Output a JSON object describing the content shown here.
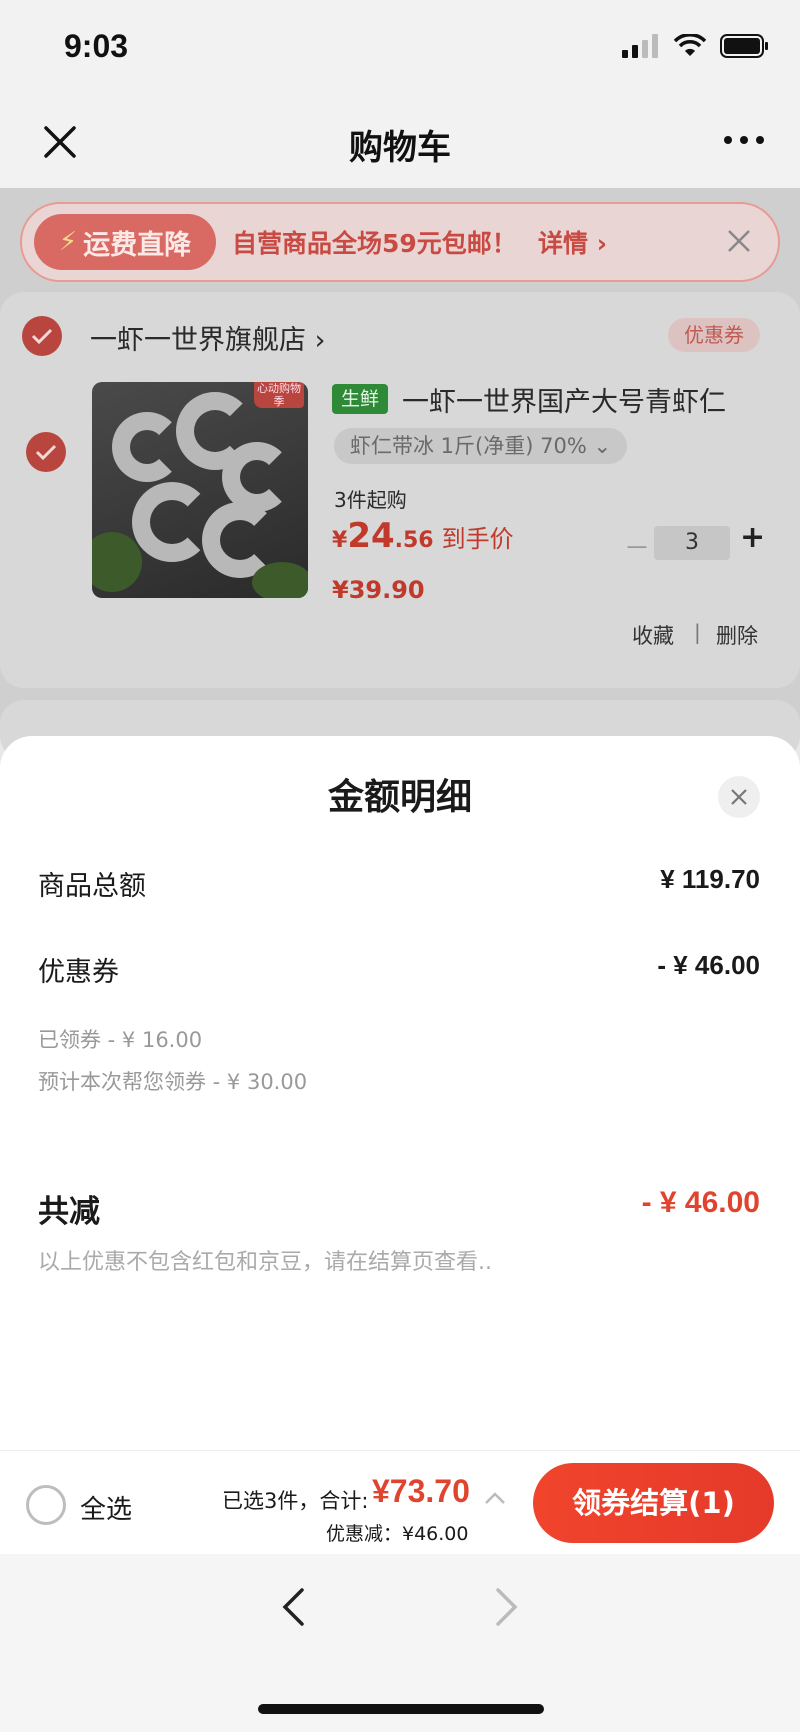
{
  "status_bar": {
    "time": "9:03"
  },
  "nav": {
    "title": "购物车"
  },
  "promo": {
    "tag": "运费直降",
    "text": "自营商品全场59元包邮！",
    "detail": "详情 ›"
  },
  "store": {
    "name": "一虾一世界旗舰店 ›",
    "coupon_label": "优惠券",
    "product": {
      "image_badge": "心动购物季",
      "fresh_tag": "生鲜",
      "title": "一虾一世界国产大号青虾仁",
      "spec": "虾仁带冰 1斤(净重) 70% ⌄",
      "min_qty": "3件起购",
      "price_currency": "¥",
      "price_int": "24",
      "price_dec": ".56",
      "price_label": "到手价",
      "original_price": "¥39.90",
      "quantity": "3",
      "qty_minus": "－",
      "qty_plus": "+",
      "favorite": "收藏",
      "separator": "|",
      "delete": "删除"
    }
  },
  "sheet": {
    "title": "金额明细",
    "goods_total_label": "商品总额",
    "goods_total_value": "¥ 119.70",
    "coupon_label": "优惠券",
    "coupon_value": "- ¥ 46.00",
    "coupon_claimed": "已领券 - ¥ 16.00",
    "coupon_estimated": "预计本次帮您领券 - ¥ 30.00",
    "total_reduce_label": "共减",
    "total_reduce_value": "- ¥ 46.00",
    "note": "以上优惠不包含红包和京豆，请在结算页查看.."
  },
  "checkout": {
    "select_all": "全选",
    "selected_text": "已选3件，合计:",
    "sum": "¥73.70",
    "discount": "优惠减：¥46.00",
    "button": "领券结算(1)"
  },
  "colors": {
    "accent": "#e0442f",
    "checkout_button": "#f0442c",
    "fresh_tag": "#2f8a38"
  }
}
